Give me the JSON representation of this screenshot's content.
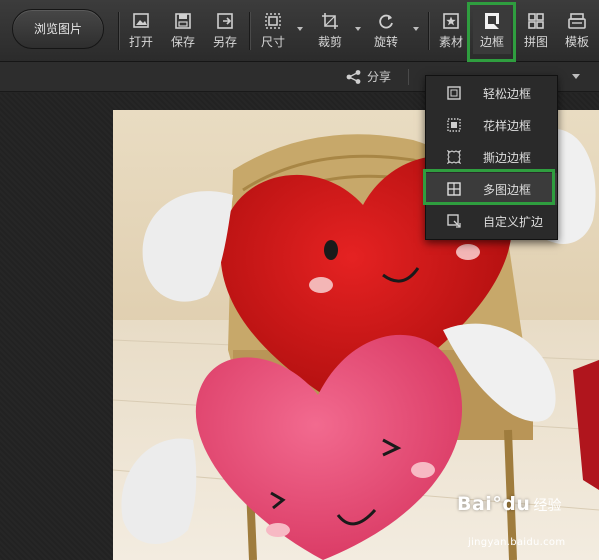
{
  "toolbar": {
    "browse_label": "浏览图片",
    "tools": [
      {
        "key": "open",
        "label": "打开",
        "icon": "open-image-icon"
      },
      {
        "key": "save",
        "label": "保存",
        "icon": "save-icon"
      },
      {
        "key": "saveas",
        "label": "另存",
        "icon": "save-as-icon"
      },
      {
        "key": "size",
        "label": "尺寸",
        "icon": "resize-icon"
      },
      {
        "key": "crop",
        "label": "裁剪",
        "icon": "crop-icon"
      },
      {
        "key": "rotate",
        "label": "旋转",
        "icon": "rotate-icon"
      },
      {
        "key": "material",
        "label": "素材",
        "icon": "material-icon"
      },
      {
        "key": "border",
        "label": "边框",
        "icon": "border-icon"
      },
      {
        "key": "collage",
        "label": "拼图",
        "icon": "collage-icon"
      },
      {
        "key": "template",
        "label": "模板",
        "icon": "template-icon"
      }
    ]
  },
  "subbar": {
    "share_label": "分享"
  },
  "border_menu": {
    "items": [
      {
        "label": "轻松边框",
        "icon": "simple-border-icon"
      },
      {
        "label": "花样边框",
        "icon": "pattern-border-icon"
      },
      {
        "label": "撕边边框",
        "icon": "torn-border-icon"
      },
      {
        "label": "多图边框",
        "icon": "multi-image-border-icon"
      },
      {
        "label": "自定义扩边",
        "icon": "custom-border-icon"
      }
    ],
    "selected_index": 3
  },
  "highlight_color": "#2f9e3f",
  "watermark": {
    "brand": "Bai°du",
    "brand_suffix": "经验",
    "url": "jingyan.baidu.com"
  }
}
